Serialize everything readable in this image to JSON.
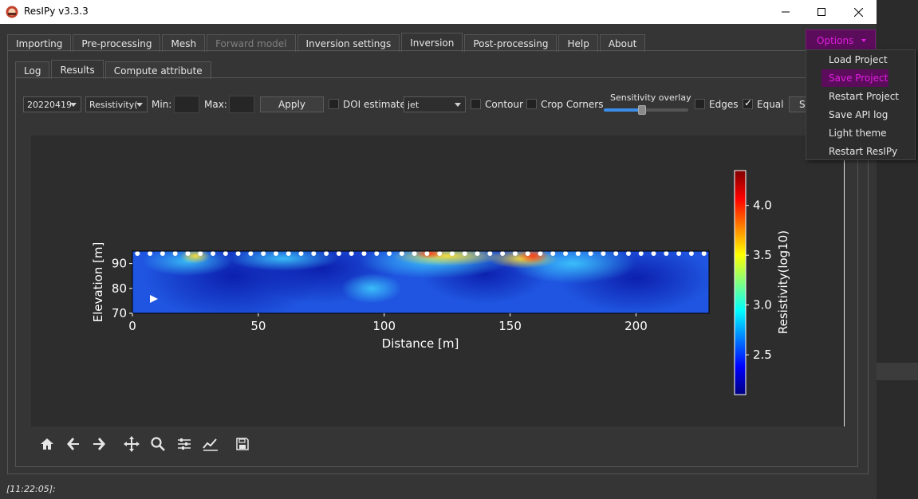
{
  "window": {
    "title": "ResIPy v3.3.3",
    "icon": "resipy-app-icon",
    "controls": [
      "minimize-icon",
      "maximize-icon",
      "close-icon"
    ]
  },
  "main_tabs": [
    {
      "label": "Importing",
      "state": "normal"
    },
    {
      "label": "Pre-processing",
      "state": "normal"
    },
    {
      "label": "Mesh",
      "state": "normal"
    },
    {
      "label": "Forward model",
      "state": "disabled"
    },
    {
      "label": "Inversion settings",
      "state": "normal"
    },
    {
      "label": "Inversion",
      "state": "active"
    },
    {
      "label": "Post-processing",
      "state": "normal"
    },
    {
      "label": "Help",
      "state": "normal"
    },
    {
      "label": "About",
      "state": "normal"
    }
  ],
  "sub_tabs": [
    {
      "label": "Log",
      "state": "normal"
    },
    {
      "label": "Results",
      "state": "active"
    },
    {
      "label": "Compute attribute",
      "state": "normal"
    }
  ],
  "toolbar": {
    "dataset_value": "20220419",
    "attribute_value": "Resistivity(",
    "min_label": "Min:",
    "max_label": "Max:",
    "apply_label": "Apply",
    "doi_label": "DOI estimate",
    "colormap_value": "jet",
    "contour_label": "Contour",
    "crop_label": "Crop Corners",
    "sensitivity_label": "Sensitivity overlay",
    "sensitivity_level": 0.45,
    "edges_label": "Edges",
    "equal_label": "Equal",
    "save_label": "Sa",
    "doi_checked": false,
    "contour_checked": false,
    "crop_checked": false,
    "edges_checked": false,
    "equal_checked": true
  },
  "options": {
    "button_label": "Options",
    "menu": [
      {
        "label": "Load Project",
        "highlighted": false
      },
      {
        "label": "Save Project",
        "highlighted": true
      },
      {
        "label": "Restart Project",
        "highlighted": false
      },
      {
        "label": "Save API log",
        "highlighted": false
      },
      {
        "label": "Light theme",
        "highlighted": false
      },
      {
        "label": "Restart ResIPy",
        "highlighted": false
      }
    ],
    "accent_color": "#e01fe0",
    "highlight_bg": "#5b0c5b"
  },
  "chart_data": {
    "type": "heatmap",
    "xlabel": "Distance [m]",
    "ylabel": "Elevation [m]",
    "xlim": [
      0,
      229
    ],
    "ylim": [
      70,
      95
    ],
    "x_ticks": [
      0,
      50,
      100,
      150,
      200
    ],
    "y_ticks": [
      70,
      80,
      90
    ],
    "colorbar": {
      "label": "Resistivity(log10)",
      "colormap": "jet",
      "range": [
        2.1,
        4.35
      ],
      "ticks": [
        2.5,
        3.0,
        3.5,
        4.0
      ]
    },
    "electrode_count": 46,
    "electrode_spacing_m": 5,
    "grid": false
  },
  "nav_toolbar": [
    "home-icon",
    "back-icon",
    "forward-icon",
    "pan-icon",
    "zoom-icon",
    "configure-subplots-icon",
    "edit-axes-icon",
    "save-figure-icon"
  ],
  "status_text": "[11:22:05]:"
}
